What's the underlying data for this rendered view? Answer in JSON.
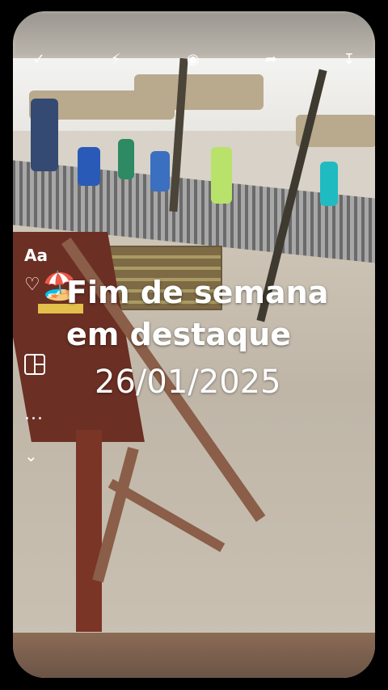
{
  "toolbar": {
    "icons": [
      "back-icon",
      "flash-icon",
      "camera-icon",
      "forward-icon",
      "download-icon"
    ]
  },
  "side_tools": {
    "text_tool": "Aa",
    "stickers_icon": "🏖",
    "more": "...",
    "chevron": "⌄"
  },
  "overlay": {
    "emoji": "🏖️",
    "title_line1": "Fim de semana",
    "title_line2": "em destaque",
    "date": "26/01/2025"
  }
}
